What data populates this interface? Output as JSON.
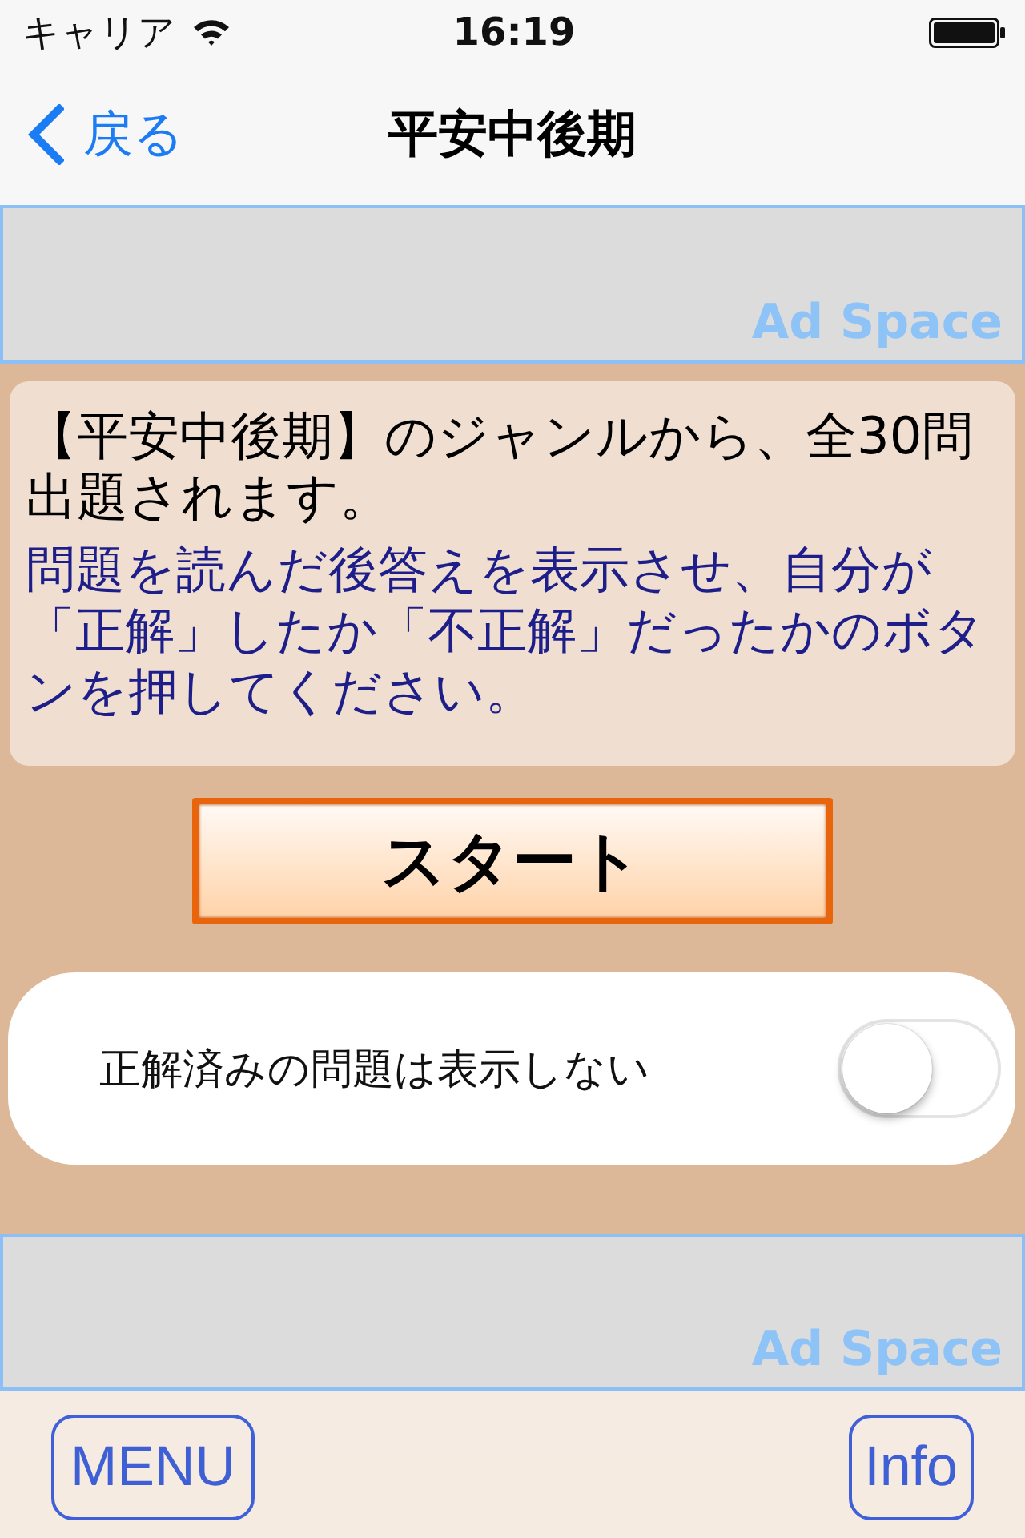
{
  "status_bar": {
    "carrier": "キャリア",
    "time": "16:19"
  },
  "nav_bar": {
    "back": "戻る",
    "title": "平安中後期"
  },
  "top_ad": {
    "label": "Ad Space"
  },
  "intro": {
    "summary": "【平安中後期】のジャンルから、全30問出題されます。",
    "instructions": "問題を読んだ後答えを表示させ、自分が「正解」したか「不正解」だったかのボタンを押してください。"
  },
  "start_button": {
    "label": "スタート"
  },
  "setting": {
    "label": "正解済みの問題は表示しない",
    "on": false
  },
  "bottom_ad": {
    "label": "Ad Space"
  },
  "toolbar": {
    "buttons": [
      {
        "label": "MENU"
      },
      {
        "label": "Info"
      }
    ]
  }
}
